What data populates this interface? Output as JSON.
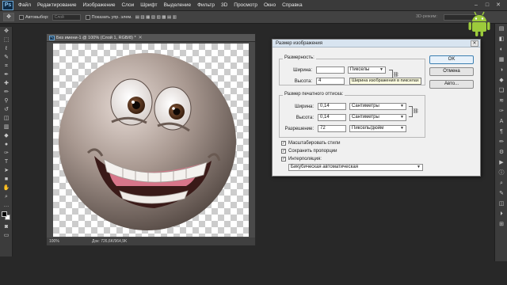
{
  "app": {
    "logo": "Ps"
  },
  "menu": [
    "Файл",
    "Редактирование",
    "Изображение",
    "Слои",
    "Шрифт",
    "Выделение",
    "Фильтр",
    "3D",
    "Просмотр",
    "Окно",
    "Справка"
  ],
  "options_bar": {
    "autoselect_label": "Автовыбор:",
    "autoselect_value": "Слой",
    "transform_label": "Показать упр. элем.",
    "mode_3d": "3D-режим:"
  },
  "document": {
    "tab_title": "Без имени-1 @ 100% (Слой 1, RGB/8) *",
    "zoom": "100%",
    "doc_size": "Док: 726,6K/964,9K"
  },
  "dialog": {
    "title": "Размер изображения",
    "pixel_dimensions_label": "Размерность:",
    "width_label": "Ширина:",
    "width_value": "",
    "width_unit": "Пикселы",
    "height_label": "Высота:",
    "height_value": "4",
    "tooltip": "Ширина изображения в пикселах",
    "print_size_label": "Размер печатного оттиска:",
    "print_width_label": "Ширина:",
    "print_width_value": "0,14",
    "print_width_unit": "Сантиметры",
    "print_height_label": "Высота:",
    "print_height_value": "0,14",
    "print_height_unit": "Сантиметры",
    "resolution_label": "Разрешение:",
    "resolution_value": "72",
    "resolution_unit": "Пиксель/дюйм",
    "scale_styles_label": "Масштабировать стили",
    "constrain_label": "Сохранить пропорции",
    "resample_label": "Интерполяция:",
    "resample_method": "Бикубическая автоматическая",
    "ok_label": "OK",
    "cancel_label": "Отмена",
    "auto_label": "Авто..."
  }
}
